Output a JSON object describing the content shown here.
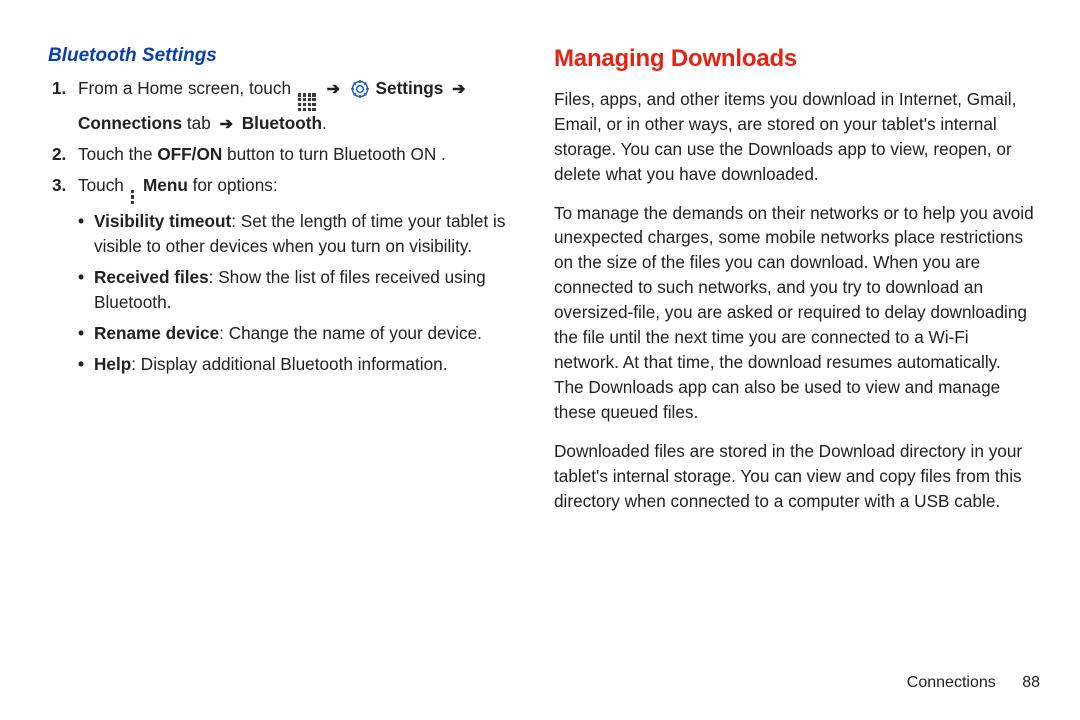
{
  "left": {
    "heading": "Bluetooth Settings",
    "step1": {
      "num": "1.",
      "pre": "From a Home screen, touch",
      "settings": "Settings",
      "conn_tab": "Connections",
      "tab_word": "tab",
      "bluetooth": "Bluetooth",
      "period": "."
    },
    "step2": {
      "num": "2.",
      "pre": "Touch the",
      "offon": "OFF/ON",
      "post": "button to turn Bluetooth ON ."
    },
    "step3": {
      "num": "3.",
      "pre": "Touch",
      "menu": "Menu",
      "post": "for options:",
      "opts": {
        "vis_b": "Visibility timeout",
        "vis_t": ": Set the length of time your tablet is visible to other devices when you turn on visibility.",
        "rec_b": "Received files",
        "rec_t": ": Show the list of files received using Bluetooth.",
        "ren_b": "Rename device",
        "ren_t": ": Change the name of your device.",
        "help_b": "Help",
        "help_t": ": Display additional Bluetooth information."
      }
    }
  },
  "right": {
    "heading": "Managing Downloads",
    "p1": "Files, apps, and other items you download in Internet, Gmail, Email, or in other ways, are stored on your tablet's internal storage. You can use the Downloads app to view, reopen, or delete what you have downloaded.",
    "p2": "To manage the demands on their networks or to help you avoid unexpected charges, some mobile networks place restrictions on the size of the files you can download. When you are connected to such networks, and you try to download an oversized-file, you are asked or required to delay downloading the file until the next time you are connected to a Wi-Fi network. At that time, the download resumes automatically. The Downloads app can also be used to view and manage these queued files.",
    "p3": "Downloaded files are stored in the Download directory in your tablet's internal storage. You can view and copy files from this directory when connected to a computer with a USB cable."
  },
  "footer": {
    "section": "Connections",
    "page": "88"
  },
  "arrow": "➔"
}
